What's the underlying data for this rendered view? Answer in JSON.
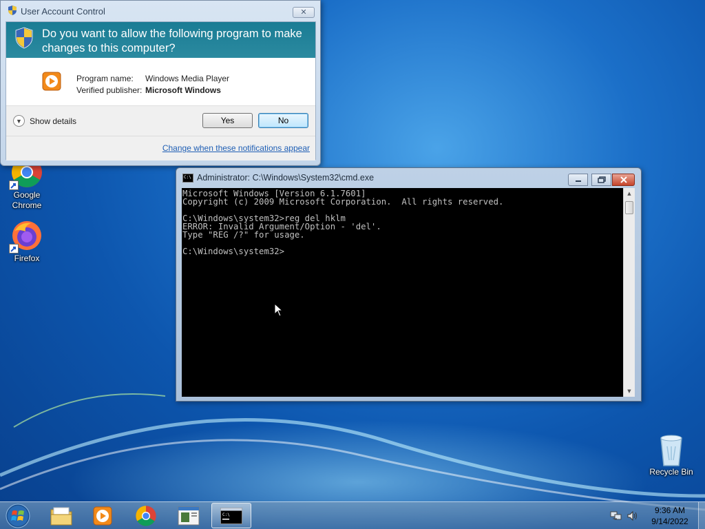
{
  "desktop": {
    "icons": [
      {
        "label": "Google Chrome"
      },
      {
        "label": "Firefox"
      },
      {
        "label": "Recycle Bin"
      }
    ]
  },
  "uac": {
    "title": "User Account Control",
    "question": "Do you want to allow the following program to make changes to this computer?",
    "program_label": "Program name:",
    "program_value": "Windows Media Player",
    "publisher_label": "Verified publisher:",
    "publisher_value": "Microsoft Windows",
    "details_label": "Show details",
    "yes_label": "Yes",
    "no_label": "No",
    "link_label": "Change when these notifications appear"
  },
  "cmd": {
    "title": "Administrator: C:\\Windows\\System32\\cmd.exe",
    "console_text": "Microsoft Windows [Version 6.1.7601]\nCopyright (c) 2009 Microsoft Corporation.  All rights reserved.\n\nC:\\Windows\\system32>reg del hklm\nERROR: Invalid Argument/Option - 'del'.\nType \"REG /?\" for usage.\n\nC:\\Windows\\system32>"
  },
  "taskbar": {
    "items": [
      {
        "icon": "explorer-icon"
      },
      {
        "icon": "media-player-icon"
      },
      {
        "icon": "chrome-icon"
      },
      {
        "icon": "window-app-icon"
      },
      {
        "icon": "cmd-icon",
        "active": true
      }
    ],
    "clock_time": "9:36 AM",
    "clock_date": "9/14/2022"
  },
  "colors": {
    "uac_banner": "#1a7c94",
    "link": "#1e5eb4",
    "console_bg": "#000000",
    "console_fg": "#c0c0c0"
  }
}
